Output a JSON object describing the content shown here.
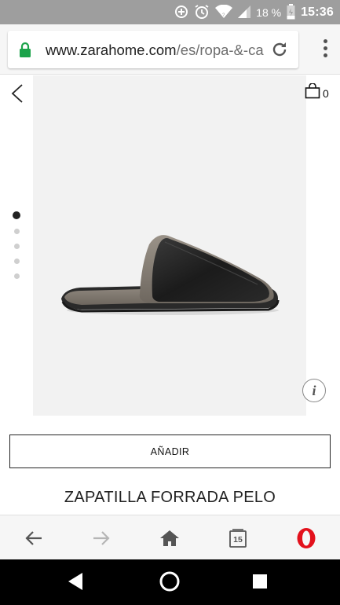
{
  "status_bar": {
    "battery_percent": "18 %",
    "time": "15:36",
    "icons": [
      "data-saver-icon",
      "alarm-icon",
      "wifi-icon",
      "signal-icon",
      "battery-charging-icon"
    ]
  },
  "browser": {
    "url_host": "www.zarahome.com",
    "url_path": "/es/ropa-&-ca",
    "secure": true
  },
  "header": {
    "cart_count": "0"
  },
  "gallery": {
    "image_count": 5,
    "active_index": 0
  },
  "product": {
    "add_button_label": "AÑADIR",
    "name": "ZAPATILLA FORRADA PELO",
    "info_label": "i"
  },
  "toolbar": {
    "tabs_count": "15",
    "buttons": [
      "back-icon",
      "forward-icon",
      "home-icon",
      "tabs-icon",
      "opera-menu-icon"
    ]
  },
  "colors": {
    "status_bar_bg": "#9e9e9e",
    "secure_lock": "#1ca34a",
    "opera_red": "#e3111c",
    "image_bg": "#f2f2f2"
  }
}
